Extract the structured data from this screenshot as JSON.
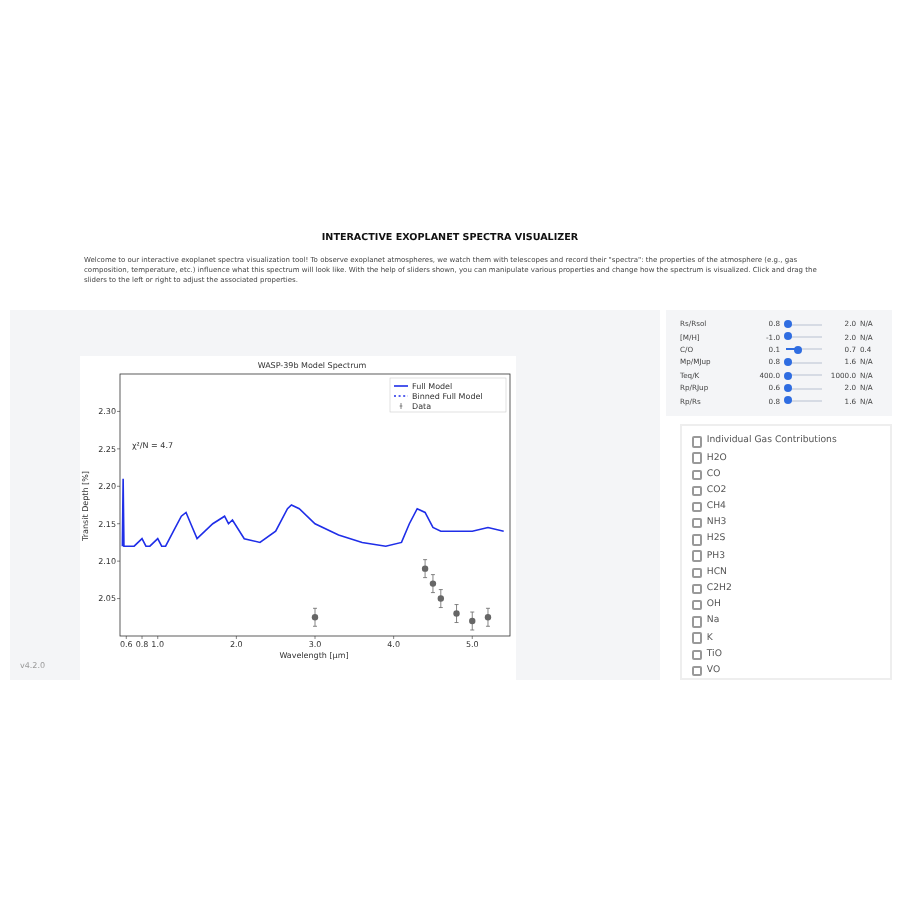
{
  "title": "INTERACTIVE EXOPLANET SPECTRA VISUALIZER",
  "intro": "Welcome to our interactive exoplanet spectra visualization tool! To observe exoplanet atmospheres, we watch them with telescopes and record their \"spectra\": the properties of the atmosphere (e.g., gas composition, temperature, etc.) influence what this spectrum will look like. With the help of sliders shown, you can manipulate various properties and change how the spectrum is visualized. Click and drag the sliders to the left or right to adjust the associated properties.",
  "plot": {
    "annotation": "χ²/N = 4.7",
    "binned_legend": "Binned Full Model",
    "chart_data": {
      "type": "line",
      "title": "WASP-39b Model Spectrum",
      "xlabel": "Wavelength [μm]",
      "ylabel": "Transit Depth [%]",
      "x": [
        0.55,
        0.56,
        0.57,
        0.7,
        0.8,
        0.85,
        0.9,
        1.0,
        1.05,
        1.1,
        1.2,
        1.3,
        1.36,
        1.42,
        1.5,
        1.7,
        1.85,
        1.9,
        1.95,
        2.1,
        2.3,
        2.5,
        2.65,
        2.7,
        2.8,
        3.0,
        3.3,
        3.6,
        3.9,
        4.1,
        4.2,
        4.3,
        4.4,
        4.5,
        4.6,
        4.8,
        5.0,
        5.2,
        5.4
      ],
      "series": [
        {
          "name": "Full Model",
          "color": "#1f2ee8",
          "values": [
            2.12,
            2.21,
            2.12,
            2.12,
            2.13,
            2.12,
            2.12,
            2.13,
            2.12,
            2.12,
            2.14,
            2.16,
            2.165,
            2.15,
            2.13,
            2.15,
            2.16,
            2.15,
            2.155,
            2.13,
            2.125,
            2.14,
            2.17,
            2.175,
            2.17,
            2.15,
            2.135,
            2.125,
            2.12,
            2.125,
            2.15,
            2.17,
            2.165,
            2.145,
            2.14,
            2.14,
            2.14,
            2.145,
            2.14
          ]
        },
        {
          "name": "Data",
          "color": "#666666",
          "type": "scatter",
          "errors": [
            null,
            null,
            null,
            null,
            null,
            null,
            null,
            null,
            null,
            null,
            null,
            null,
            null,
            null,
            null,
            null,
            null,
            null,
            null,
            null,
            null,
            null,
            null,
            null,
            null,
            0.012,
            null,
            null,
            null,
            null,
            null,
            null,
            0.012,
            0.012,
            0.012,
            0.012,
            0.012,
            0.012,
            null
          ],
          "values": [
            null,
            null,
            null,
            null,
            null,
            null,
            null,
            null,
            null,
            null,
            null,
            null,
            null,
            null,
            null,
            null,
            null,
            null,
            null,
            null,
            null,
            null,
            null,
            null,
            null,
            2.025,
            null,
            null,
            null,
            null,
            null,
            null,
            2.09,
            2.07,
            2.05,
            2.03,
            2.02,
            2.025,
            null
          ]
        }
      ],
      "xlim": [
        0.52,
        5.48
      ],
      "ylim": [
        2.0,
        2.35
      ],
      "legend": "upper right",
      "xticks": [
        {
          "value": 0.6,
          "label": "0.6"
        },
        {
          "value": 0.8,
          "label": "0.8"
        },
        {
          "value": 1.0,
          "label": "1.0"
        },
        {
          "value": 2.0,
          "label": "2.0"
        },
        {
          "value": 3.0,
          "label": "3.0"
        },
        {
          "value": 4.0,
          "label": "4.0"
        },
        {
          "value": 5.0,
          "label": "5.0"
        }
      ],
      "yticks": [
        {
          "value": 2.3,
          "label": "2.30"
        },
        {
          "value": 2.25,
          "label": "2.25"
        },
        {
          "value": 2.2,
          "label": "2.20"
        },
        {
          "value": 2.15,
          "label": "2.15"
        },
        {
          "value": 2.1,
          "label": "2.10"
        },
        {
          "value": 2.05,
          "label": "2.05"
        }
      ]
    }
  },
  "footer_note": "v4.2.0",
  "sliders": [
    {
      "label": "Rs/Rsol",
      "min": "0.8",
      "max": "2.0",
      "value": "N/A",
      "level": 0.04
    },
    {
      "label": "[M/H]",
      "min": "-1.0",
      "max": "2.0",
      "value": "N/A",
      "level": 0.04
    },
    {
      "label": "C/O",
      "min": "0.1",
      "max": "0.7",
      "value": "0.4",
      "level": 0.35
    },
    {
      "label": "Mp/MJup",
      "min": "0.8",
      "max": "1.6",
      "value": "N/A",
      "level": 0.04
    },
    {
      "label": "Teq/K",
      "min": "400.0",
      "max": "1000.0",
      "value": "N/A",
      "level": 0.04
    },
    {
      "label": "Rp/RJup",
      "min": "0.6",
      "max": "2.0",
      "value": "N/A",
      "level": 0.04
    },
    {
      "label": "Rp/Rs",
      "min": "0.8",
      "max": "1.6",
      "value": "N/A",
      "level": 0.04
    }
  ],
  "gases": [
    {
      "label": "Individual Gas Contributions",
      "checked": false
    },
    {
      "label": "H2O",
      "checked": false
    },
    {
      "label": "CO",
      "checked": false
    },
    {
      "label": "CO2",
      "checked": false
    },
    {
      "label": "CH4",
      "checked": false
    },
    {
      "label": "NH3",
      "checked": false
    },
    {
      "label": "H2S",
      "checked": false
    },
    {
      "label": "PH3",
      "checked": false
    },
    {
      "label": "HCN",
      "checked": false
    },
    {
      "label": "C2H2",
      "checked": false
    },
    {
      "label": "OH",
      "checked": false
    },
    {
      "label": "Na",
      "checked": false
    },
    {
      "label": "K",
      "checked": false
    },
    {
      "label": "TiO",
      "checked": false
    },
    {
      "label": "VO",
      "checked": false
    }
  ]
}
